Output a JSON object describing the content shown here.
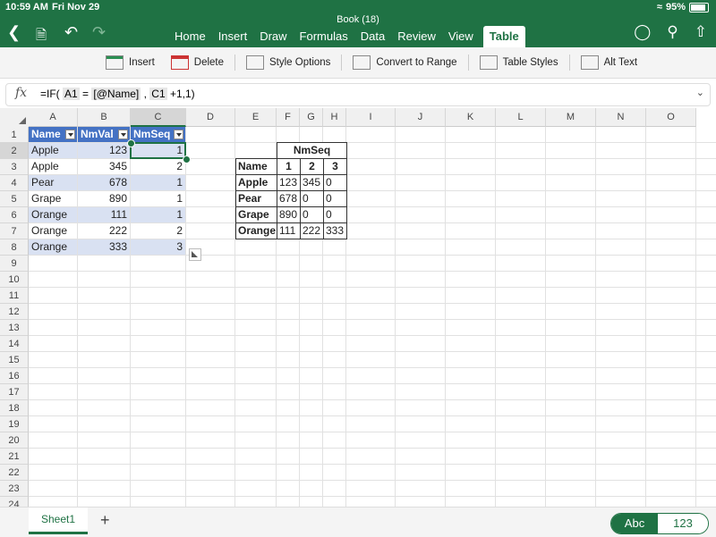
{
  "status": {
    "time": "10:59 AM",
    "date": "Fri Nov 29",
    "battery": "95%"
  },
  "document": {
    "title": "Book (18)"
  },
  "tabs": [
    "Home",
    "Insert",
    "Draw",
    "Formulas",
    "Data",
    "Review",
    "View",
    "Table"
  ],
  "active_tab": "Table",
  "ribbon": {
    "insert": "Insert",
    "delete": "Delete",
    "style_options": "Style Options",
    "convert": "Convert to Range",
    "table_styles": "Table Styles",
    "alt_text": "Alt Text"
  },
  "formula": {
    "prefix": "=IF(",
    "ref1": "A1",
    "mid1": "=",
    "ref2": "[@Name]",
    "mid2": ",",
    "ref3": "C1",
    "suffix": "+1,1)"
  },
  "columns": [
    "A",
    "B",
    "C",
    "D",
    "E",
    "F",
    "G",
    "H",
    "I",
    "J",
    "K",
    "L",
    "M",
    "N",
    "O"
  ],
  "rows": [
    "1",
    "2",
    "3",
    "4",
    "5",
    "6",
    "7",
    "8",
    "9",
    "10",
    "11",
    "12",
    "13",
    "14",
    "15",
    "16",
    "17",
    "18",
    "19",
    "20",
    "21",
    "22",
    "23",
    "24"
  ],
  "table": {
    "headers": [
      "Name",
      "NmVal",
      "NmSeq"
    ],
    "rows": [
      [
        "Apple",
        "123",
        "1"
      ],
      [
        "Apple",
        "345",
        "2"
      ],
      [
        "Pear",
        "678",
        "1"
      ],
      [
        "Grape",
        "890",
        "1"
      ],
      [
        "Orange",
        "111",
        "1"
      ],
      [
        "Orange",
        "222",
        "2"
      ],
      [
        "Orange",
        "333",
        "3"
      ]
    ]
  },
  "pivot": {
    "title": "NmSeq",
    "header": [
      "Name",
      "1",
      "2",
      "3"
    ],
    "rows": [
      [
        "Apple",
        "123",
        "345",
        "0"
      ],
      [
        "Pear",
        "678",
        "0",
        "0"
      ],
      [
        "Grape",
        "890",
        "0",
        "0"
      ],
      [
        "Orange",
        "111",
        "222",
        "333"
      ]
    ]
  },
  "sheet_tab": "Sheet1",
  "add_sheet": "+",
  "keyboard": {
    "abc": "Abc",
    "num": "123"
  },
  "icons": {
    "back": "chevron-left-icon",
    "file": "file-icon",
    "undo": "undo-icon",
    "redo": "redo-icon",
    "ideas": "lightbulb-icon",
    "search": "search-icon",
    "share": "share-icon"
  }
}
